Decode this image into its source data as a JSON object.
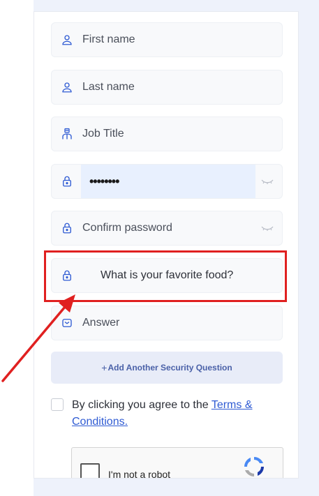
{
  "form": {
    "first_name_placeholder": "First name",
    "last_name_placeholder": "Last name",
    "job_title_placeholder": "Job Title",
    "password_value": "••••••••",
    "confirm_password_placeholder": "Confirm password",
    "security_question_selected": "What is your favorite food?",
    "answer_placeholder": "Answer",
    "add_question_button": "Add Another Security Question",
    "add_question_plus": "+",
    "terms_prefix": "By clicking you agree to the ",
    "terms_link": "Terms & Conditions."
  },
  "recaptcha": {
    "label": "I'm not a robot"
  },
  "icons": {
    "first_name": "user-icon",
    "last_name": "user-icon",
    "job_title": "briefcase-user-icon",
    "password": "lock-icon",
    "confirm_password": "lock-icon",
    "security_question": "lock-icon",
    "answer": "envelope-icon",
    "password_toggle": "eye-closed-icon"
  },
  "colors": {
    "accent": "#2f5bd3",
    "highlight_box": "#e02020",
    "autofill_bg": "#e8f0fe"
  }
}
